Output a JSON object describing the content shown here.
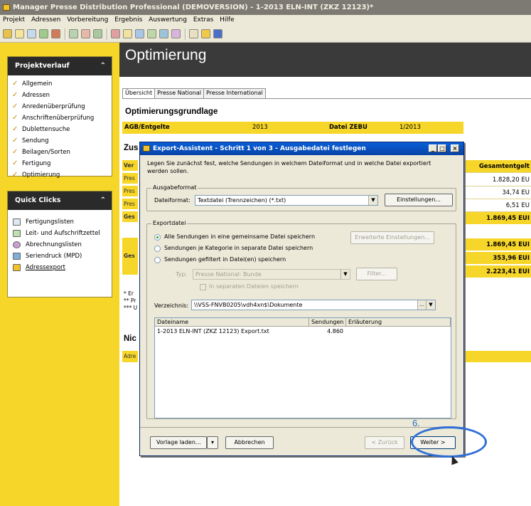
{
  "window": {
    "title": "Manager Presse Distribution Professional (DEMOVERSION) - 1-2013 ELN-INT (ZKZ 12123)*"
  },
  "menu": [
    "Projekt",
    "Adressen",
    "Vorbereitung",
    "Ergebnis",
    "Auswertung",
    "Extras",
    "Hilfe"
  ],
  "sidebar": {
    "project_title": "Projektverlauf",
    "project_items": [
      "Allgemein",
      "Adressen",
      "Anredenüberprüfung",
      "Anschriftenüberprüfung",
      "Dublettensuche",
      "Sendung",
      "Beilagen/Sorten",
      "Fertigung",
      "Optimierung"
    ],
    "quick_title": "Quick Clicks",
    "quick_items": [
      "Fertigungslisten",
      "Leit- und Aufschriftzettel",
      "Abrechnungslisten",
      "Seriendruck (MPD)",
      "Adressexport"
    ]
  },
  "main": {
    "title": "Optimierung",
    "tabs": [
      "Übersicht",
      "Presse National",
      "Presse International"
    ],
    "section1": "Optimierungsgrundlage",
    "agb_label": "AGB/Entgelte",
    "agb_value": "2013",
    "zebu_label": "Datei ZEBU",
    "zebu_value": "1/2013",
    "section2_stub": "Zus",
    "stub_rows": [
      "Ver",
      "Pres",
      "Pres",
      "Pres",
      "Ges"
    ],
    "stub_ges2": "Ges",
    "notes": [
      "* Er",
      "** Pr",
      "*** U"
    ],
    "section3_stub": "Nic",
    "adre_stub": "Adre",
    "gesamt_header": "Gesamtentgelt",
    "gesamt_values": [
      "1.828,20 EU",
      "34,74 EU",
      "6,51 EU"
    ],
    "gesamt_total": "1.869,45 EUI",
    "gesamt_block": [
      "1.869,45 EUI",
      "353,96 EUI",
      "2.223,41 EUI"
    ]
  },
  "dialog": {
    "title": "Export-Assistent - Schritt 1 von 3 - Ausgabedatei festlegen",
    "intro": "Legen Sie zunächst fest, welche Sendungen in welchem Dateiformat und in welche Datei exportiert werden sollen.",
    "ausgabeformat_group": "Ausgabeformat",
    "dateiformat_label": "Dateiformat:",
    "dateiformat_value": "Textdatei (Trennzeichen) (*.txt)",
    "einstellungen_btn": "Einstellungen...",
    "exportdatei_group": "Exportdatei",
    "radio_options": [
      "Alle Sendungen in eine gemeinsame Datei speichern",
      "Sendungen je Kategorie in separate Datei speichern",
      "Sendungen gefiltert in Datei(en) speichern"
    ],
    "erweiterte_btn": "Erweiterte Einstellungen...",
    "typ_label": "Typ:",
    "typ_value": "Presse National: Bunde",
    "filter_btn": "Filter...",
    "separate_chk": "In separaten Dateien speichern",
    "verzeichnis_label": "Verzeichnis:",
    "verzeichnis_value": "\\\\VSS-FNVB0205\\vdh4xn$\\Dokumente",
    "list_headers": [
      "Dateiname",
      "Sendungen",
      "Erläuterung"
    ],
    "list_rows": [
      {
        "name": "1-2013 ELN-INT (ZKZ 12123) Export.txt",
        "count": "4.860",
        "note": ""
      }
    ],
    "vorlage_btn": "Vorlage laden...",
    "abbrechen_btn": "Abbrechen",
    "zurueck_btn": "< Zurück",
    "weiter_btn": "Weiter >"
  },
  "annotation": {
    "step": "6."
  }
}
